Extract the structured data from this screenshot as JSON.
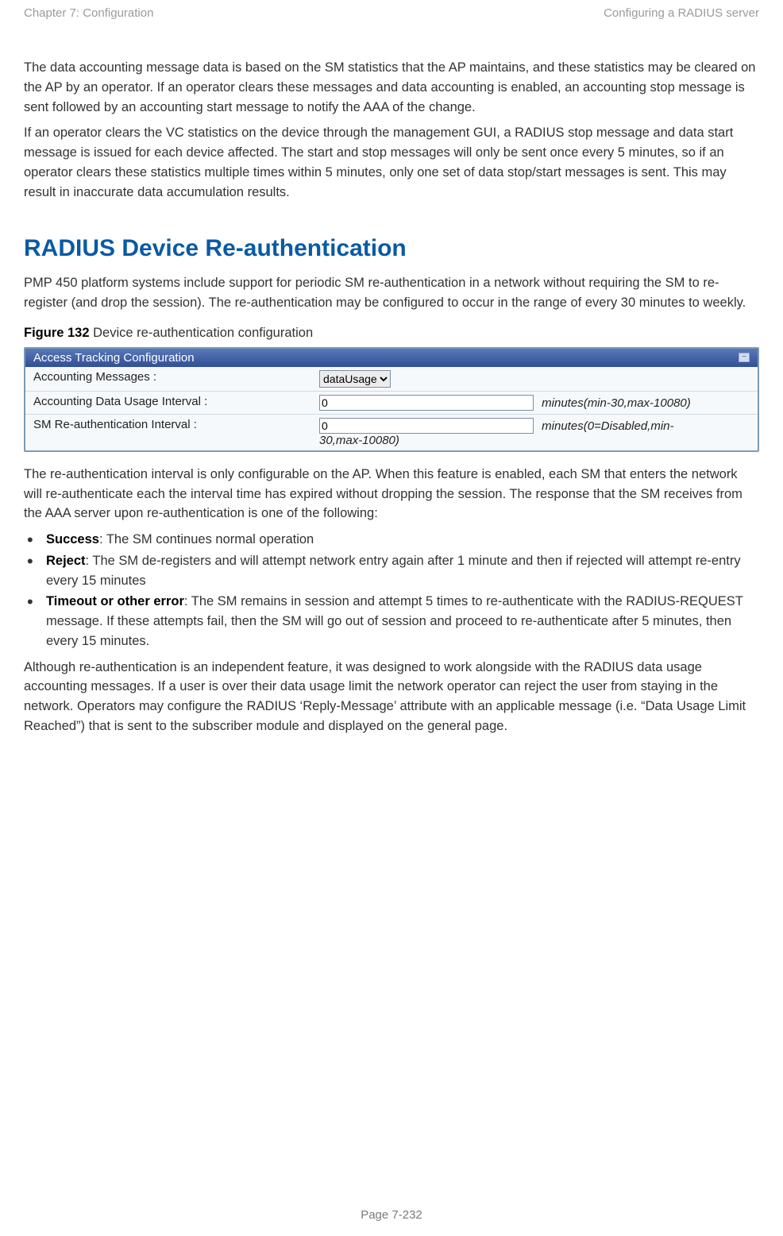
{
  "header": {
    "left": "Chapter 7:  Configuration",
    "right": "Configuring a RADIUS server"
  },
  "para1": "The data accounting message data is based on the SM statistics that the AP maintains, and these statistics may be cleared on the AP by an operator. If an operator clears these messages and data accounting is enabled, an accounting stop message is sent followed by an accounting start message to notify the AAA of the change.",
  "para2": "If an operator clears the VC statistics on the device through the management GUI, a RADIUS stop message and data start message is issued for each device affected. The start and stop messages will only be sent once every 5 minutes, so if an operator clears these statistics multiple times within 5 minutes, only one set of data stop/start messages is sent. This may result in inaccurate data accumulation results.",
  "heading": "RADIUS Device Re-authentication",
  "para3": "PMP 450 platform systems include support for periodic SM re-authentication in a network without requiring the SM to re-register (and drop the session). The re-authentication may be configured to occur in the range of every 30 minutes to weekly.",
  "figure": {
    "label": "Figure 132",
    "caption_rest": " Device re-authentication configuration"
  },
  "panel": {
    "title": "Access Tracking Configuration",
    "rows": {
      "r1": {
        "label": "Accounting Messages :",
        "value": "dataUsage"
      },
      "r2": {
        "label": "Accounting Data Usage Interval :",
        "value": "0",
        "hint": "minutes(min-30,max-10080)"
      },
      "r3": {
        "label": "SM Re-authentication Interval :",
        "value": "0",
        "hint_a": "minutes(0=Disabled,min-",
        "hint_b": "30,max-10080)"
      }
    }
  },
  "para4": "The re-authentication interval is only configurable on the AP. When this feature is enabled, each SM that enters the network will re-authenticate each the interval time has expired without dropping the session. The response that the SM receives from the AAA server upon re-authentication is one of the following:",
  "bullets": {
    "b1": {
      "strong": "Success",
      "rest": ": The SM continues normal operation"
    },
    "b2": {
      "strong": "Reject",
      "rest": ": The SM de-registers and will attempt network entry again after 1 minute and then if rejected will attempt re-entry every 15 minutes"
    },
    "b3": {
      "strong": "Timeout or other error",
      "rest": ": The SM remains in session and attempt 5 times to re-authenticate with the RADIUS-REQUEST message. If these attempts fail, then the SM will go out of session and proceed to re-authenticate after 5 minutes, then every 15 minutes."
    }
  },
  "para5": "Although re-authentication is an independent feature, it was designed to work alongside with the RADIUS data usage accounting messages. If a user is over their data usage limit the network operator can reject the user from staying in the network. Operators may configure the RADIUS ‘Reply-Message’ attribute with an applicable message (i.e. “Data Usage Limit Reached”) that is sent to the subscriber module and displayed on the general page.",
  "footer": "Page 7-232"
}
